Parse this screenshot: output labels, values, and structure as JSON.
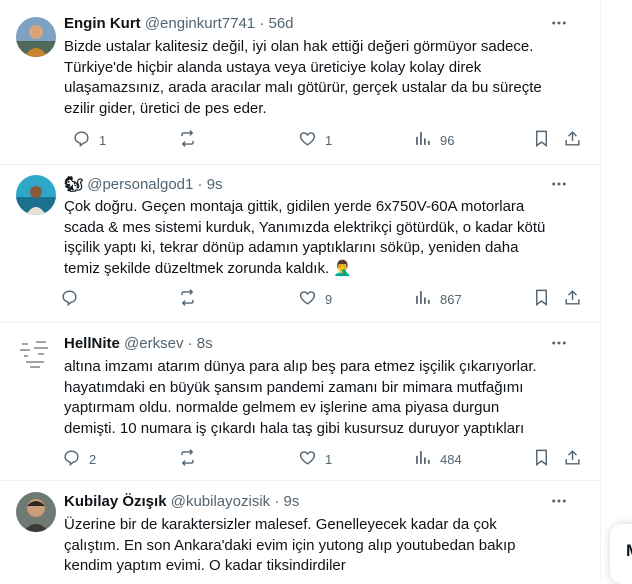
{
  "tweets": [
    {
      "name": "Engin Kurt",
      "handle": "@enginkurt7741",
      "time": "56d",
      "text": "Bizde ustalar kalitesiz değil, iyi olan hak ettiği değeri görmüyor sadece. Türkiye'de hiçbir alanda ustaya veya üreticiye kolay kolay direk ulaşamazsınız, arada aracılar malı götürür, gerçek ustalar da bu süreçte ezilir gider, üretici de pes eder.",
      "replies": "1",
      "retweets": "",
      "likes": "1",
      "views": "96"
    },
    {
      "name": "",
      "emoji": "🐿",
      "handle": "@personalgod1",
      "time": "9s",
      "text": "Çok doğru. Geçen montaja gittik, gidilen yerde 6x750V-60A motorlara scada & mes sistemi kurduk, Yanımızda elektrikçi götürdük, o kadar kötü işçilik yaptı ki, tekrar dönüp adamın yaptıklarını söküp, yeniden daha temiz şekilde düzeltmek zorunda kaldık. 🤦‍♂️",
      "replies": "",
      "retweets": "",
      "likes": "9",
      "views": "867"
    },
    {
      "name": "HellNite",
      "handle": "@erksev",
      "time": "8s",
      "text": "altına imzamı atarım dünya para alıp beş para etmez işçilik çıkarıyorlar. hayatımdaki en büyük şansım pandemi zamanı bir mimara mutfağımı yaptırmam oldu. normalde gelmem ev işlerine ama piyasa durgun demişti. 10 numara iş çıkardı hala taş gibi kusursuz duruyor yaptıkları",
      "replies": "2",
      "retweets": "",
      "likes": "1",
      "views": "484"
    },
    {
      "name": "Kubilay Özışık",
      "handle": "@kubilayozisik",
      "time": "9s",
      "text": "Üzerine bir de karaktersizler malesef. Genelleyecek kadar da çok çalıştım. En son Ankara'daki evim için yutong alıp youtubedan bakıp kendim yaptım evimi. O kadar tiksindirdiler"
    }
  ],
  "side": {
    "letter": "M"
  }
}
